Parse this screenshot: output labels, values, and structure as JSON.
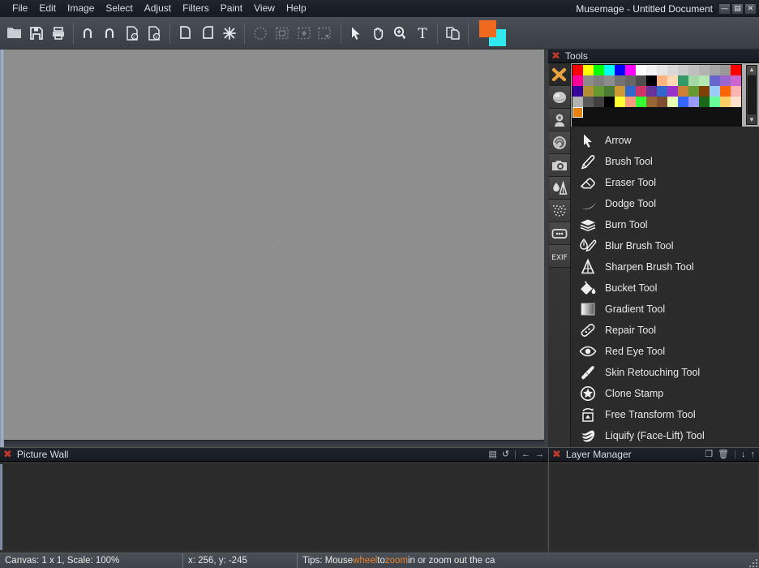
{
  "window": {
    "title": "Musemage - Untitled Document",
    "buttons": [
      {
        "name": "minimize",
        "glyph": "—"
      },
      {
        "name": "maximize",
        "glyph": "▤"
      },
      {
        "name": "close",
        "glyph": "✕"
      }
    ]
  },
  "menubar": {
    "items": [
      {
        "label": "File"
      },
      {
        "label": "Edit"
      },
      {
        "label": "Image"
      },
      {
        "label": "Select"
      },
      {
        "label": "Adjust"
      },
      {
        "label": "Filters"
      },
      {
        "label": "Paint"
      },
      {
        "label": "View"
      },
      {
        "label": "Help"
      }
    ]
  },
  "toolbar": {
    "groups": [
      [
        {
          "icon": "open-folder-icon",
          "label": "Open",
          "disabled": false
        },
        {
          "icon": "save-icon",
          "label": "Save",
          "disabled": false
        },
        {
          "icon": "print-icon",
          "label": "Print",
          "disabled": false
        }
      ],
      [
        {
          "icon": "undo-icon",
          "label": "Undo",
          "disabled": false
        },
        {
          "icon": "redo-icon",
          "label": "Redo",
          "disabled": false
        },
        {
          "icon": "copy-doc-icon",
          "label": "Copy",
          "disabled": false
        },
        {
          "icon": "paste-doc-icon",
          "label": "Paste",
          "disabled": false
        }
      ],
      [
        {
          "icon": "rotate-left-icon",
          "label": "Rotate Left",
          "disabled": false
        },
        {
          "icon": "rotate-right-icon",
          "label": "Rotate Right",
          "disabled": false
        },
        {
          "icon": "auto-enhance-icon",
          "label": "Auto Enhance",
          "disabled": false
        }
      ],
      [
        {
          "icon": "lasso-select-icon",
          "label": "Lasso Select",
          "disabled": true
        },
        {
          "icon": "rect-select-icon",
          "label": "Rectangle Select",
          "disabled": true
        },
        {
          "icon": "magic-wand-select-icon",
          "label": "Magic Select",
          "disabled": true
        },
        {
          "icon": "select-dropdown-icon",
          "label": "Select Options",
          "disabled": true
        }
      ],
      [
        {
          "icon": "arrow-pointer-icon",
          "label": "Arrow",
          "disabled": false
        },
        {
          "icon": "hand-pan-icon",
          "label": "Pan",
          "disabled": false
        },
        {
          "icon": "zoom-magnifier-icon",
          "label": "Zoom",
          "disabled": false
        },
        {
          "icon": "text-tool-icon",
          "label": "Text",
          "disabled": false
        }
      ],
      [
        {
          "icon": "duplicate-layer-icon",
          "label": "Duplicate",
          "disabled": false
        }
      ]
    ],
    "color_swatches": {
      "foreground": "#ef6a1e",
      "background": "#30e8f0",
      "foreground_name": "foreground-color-swatch",
      "background_name": "background-color-swatch"
    }
  },
  "tools_panel": {
    "title": "Tools",
    "close_icon": "✖",
    "rail": [
      {
        "name": "tools-icon",
        "selected": true
      },
      {
        "name": "effects-sphere-icon",
        "selected": false
      },
      {
        "name": "badge-stamp-icon",
        "selected": false
      },
      {
        "name": "swirl-distort-icon",
        "selected": false
      },
      {
        "name": "camera-preview-icon",
        "selected": false
      },
      {
        "name": "blur-sharpen-icon",
        "selected": false
      },
      {
        "name": "noise-grain-icon",
        "selected": false
      },
      {
        "name": "frame-dots-icon",
        "selected": false
      },
      {
        "name": "exif-info-icon",
        "selected": false,
        "text": "EXIF"
      }
    ],
    "palette": {
      "selected_swatch_index": 64,
      "colors": [
        "#ff0000",
        "#ffff00",
        "#00ff00",
        "#00ffff",
        "#0000ff",
        "#ff00ff",
        "#ffffff",
        "#f2f2f2",
        "#e6e6e6",
        "#d9d9d9",
        "#cccccc",
        "#bfbfbf",
        "#b3b3b3",
        "#a6a6a6",
        "#999999",
        "#ff0000",
        "#ff0099",
        "#8c8c8c",
        "#7f7f7f",
        "#8c8c8c",
        "#737373",
        "#666666",
        "#4d4d4d",
        "#000000",
        "#ffb380",
        "#ffd9b3",
        "#339966",
        "#a6d9a6",
        "#b3e6b3",
        "#6666cc",
        "#9966cc",
        "#cc66cc",
        "#330099",
        "#b38f33",
        "#669933",
        "#4d7a33",
        "#cc9933",
        "#3366cc",
        "#cc3366",
        "#663399",
        "#3366cc",
        "#9933cc",
        "#cc8033",
        "#669933",
        "#804000",
        "#99ccff",
        "#ff6600",
        "#ffb3b3",
        "#b3b3b3",
        "#595959",
        "#404040",
        "#000000",
        "#ffff33",
        "#ff9980",
        "#33ff33",
        "#996633",
        "#804d33",
        "#e6ffb3",
        "#3366ff",
        "#9999ff",
        "#1a661a",
        "#66ff99",
        "#ffcc66",
        "#ffe0cc",
        "#e8820e"
      ]
    },
    "tools": [
      {
        "label": "Arrow",
        "icon": "arrow-pointer-icon"
      },
      {
        "label": "Brush Tool",
        "icon": "brush-pen-icon"
      },
      {
        "label": "Eraser Tool",
        "icon": "eraser-icon"
      },
      {
        "label": "Dodge Tool",
        "icon": "dodge-crescent-icon"
      },
      {
        "label": "Burn Tool",
        "icon": "burn-layers-icon"
      },
      {
        "label": "Blur Brush Tool",
        "icon": "blur-drop-brush-icon"
      },
      {
        "label": "Sharpen Brush Tool",
        "icon": "sharpen-triangle-icon"
      },
      {
        "label": "Bucket Tool",
        "icon": "paint-bucket-icon"
      },
      {
        "label": "Gradient Tool",
        "icon": "gradient-square-icon"
      },
      {
        "label": "Repair Tool",
        "icon": "repair-bandage-icon"
      },
      {
        "label": "Red Eye Tool",
        "icon": "red-eye-icon"
      },
      {
        "label": "Skin Retouching Tool",
        "icon": "skin-brush-icon"
      },
      {
        "label": "Clone Stamp",
        "icon": "clone-stamp-star-icon"
      },
      {
        "label": "Free Transform Tool",
        "icon": "free-transform-icon"
      },
      {
        "label": "Liquify (Face-Lift) Tool",
        "icon": "liquify-swirl-icon"
      }
    ]
  },
  "picture_wall": {
    "title": "Picture Wall",
    "close_icon": "✖",
    "actions": [
      {
        "name": "open-folder-icon",
        "glyph": "▤"
      },
      {
        "name": "refresh-icon",
        "glyph": "↺"
      },
      {
        "name": "prev-arrow-icon",
        "glyph": "←"
      },
      {
        "name": "next-arrow-icon",
        "glyph": "→"
      }
    ]
  },
  "layer_manager": {
    "title": "Layer Manager",
    "close_icon": "✖",
    "actions": [
      {
        "name": "add-layer-icon",
        "glyph": "❐"
      },
      {
        "name": "delete-layer-icon",
        "glyph": "🗑"
      },
      {
        "name": "move-layer-down-icon",
        "glyph": "↓"
      },
      {
        "name": "move-layer-up-icon",
        "glyph": "↑"
      }
    ]
  },
  "statusbar": {
    "canvas_info": "Canvas: 1 x 1, Scale: 100%",
    "coordinates": "x: 256, y: -245",
    "tip_prefix": "Tips: Mouse ",
    "tip_word1": "wheel",
    "tip_mid": " to ",
    "tip_word2": "zoom",
    "tip_suffix": " in or zoom out the ca",
    "highlight_color": "#e8822e"
  }
}
